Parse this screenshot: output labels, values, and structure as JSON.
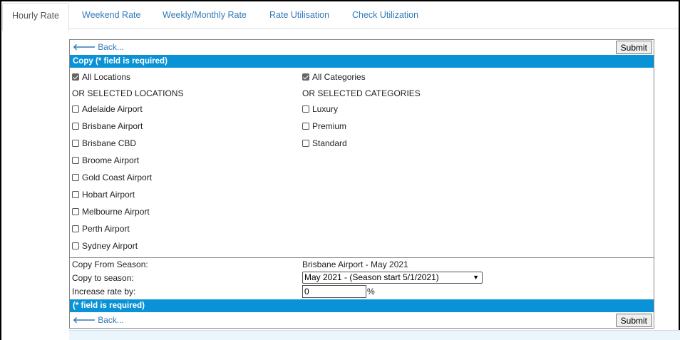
{
  "tabs": [
    {
      "label": "Hourly Rate",
      "active": true
    },
    {
      "label": "Weekend Rate",
      "active": false
    },
    {
      "label": "Weekly/Monthly Rate",
      "active": false
    },
    {
      "label": "Rate Utilisation",
      "active": false
    },
    {
      "label": "Check Utilization",
      "active": false
    }
  ],
  "toolbar": {
    "back_label": "Back...",
    "back_icon": "arrow-left-icon",
    "submit_label": "Submit"
  },
  "header_bar": "Copy (* field is required)",
  "locations": {
    "all_label": "All Locations",
    "all_checked": true,
    "or_label": "OR SELECTED LOCATIONS",
    "items": [
      "Adelaide Airport",
      "Brisbane Airport",
      "Brisbane CBD",
      "Broome Airport",
      "Gold Coast Airport",
      "Hobart Airport",
      "Melbourne Airport",
      "Perth Airport",
      "Sydney Airport"
    ]
  },
  "categories": {
    "all_label": "All Categories",
    "all_checked": true,
    "or_label": "OR SELECTED CATEGORIES",
    "items": [
      "Luxury",
      "Premium",
      "Standard"
    ]
  },
  "form": {
    "copy_from_label": "Copy From Season:",
    "copy_from_value": "Brisbane Airport - May 2021",
    "copy_to_label": "Copy to season:",
    "copy_to_value": "May 2021 - (Season start 5/1/2021)",
    "increase_label": "Increase rate by:",
    "increase_value": "0",
    "percent": "%"
  },
  "footer_bar": "(* field is required)",
  "colors": {
    "accent": "#0a92d6",
    "link": "#337ab7"
  }
}
